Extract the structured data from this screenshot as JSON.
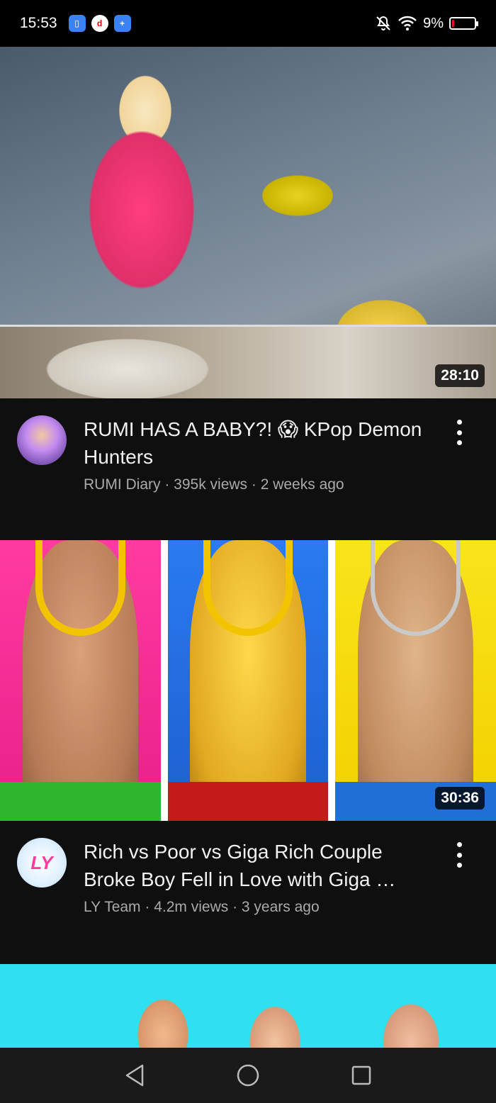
{
  "status_bar": {
    "time": "15:53",
    "battery_percent": "9%",
    "battery_level": 0.09,
    "icons": [
      "app-badge-blue-icon",
      "app-badge-d-icon",
      "app-badge-plus-icon",
      "bell-off-icon",
      "wifi-icon",
      "battery-icon"
    ]
  },
  "videos": [
    {
      "duration": "28:10",
      "title": "RUMI HAS A BABY?! 😱 KPop Demon Hunters",
      "channel": "RUMI Diary",
      "sub": "RUMI Diary · 395k views · 2 weeks ago"
    },
    {
      "duration": "30:36",
      "title": "Rich vs Poor vs Giga Rich Couple Broke Boy Fell in Love with Giga …",
      "channel": "LY Team",
      "avatar_text": "LY",
      "sub": "LY Team · 4.2m views · 3 years ago"
    },
    {
      "duration": "",
      "title": "",
      "sub": ""
    }
  ],
  "nav": {
    "icons": [
      "back-icon",
      "home-icon",
      "recents-icon"
    ]
  }
}
